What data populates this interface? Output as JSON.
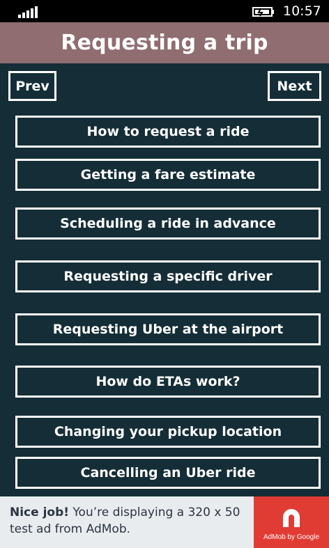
{
  "status_bar": {
    "time": "10:57",
    "signal_icon": "signal-bars-icon",
    "battery_icon": "battery-charging-icon"
  },
  "header": {
    "title": "Requesting a trip"
  },
  "nav": {
    "prev_label": "Prev",
    "next_label": "Next"
  },
  "topics": [
    {
      "label": "How to request a ride"
    },
    {
      "label": "Getting a fare estimate"
    },
    {
      "label": "Scheduling a ride in advance"
    },
    {
      "label": "Requesting a specific driver"
    },
    {
      "label": "Requesting Uber at the airport"
    },
    {
      "label": "How do ETAs work?"
    },
    {
      "label": "Changing your pickup location"
    },
    {
      "label": "Cancelling an Uber ride"
    }
  ],
  "ad": {
    "headline": "Nice job!",
    "body": " You’re displaying a 320 x 50 test ad from AdMob.",
    "brand": "AdMob by Google",
    "brand_color": "#e13c34"
  },
  "colors": {
    "background": "#152d36",
    "header": "#8f6d70",
    "text": "#ffffff"
  }
}
